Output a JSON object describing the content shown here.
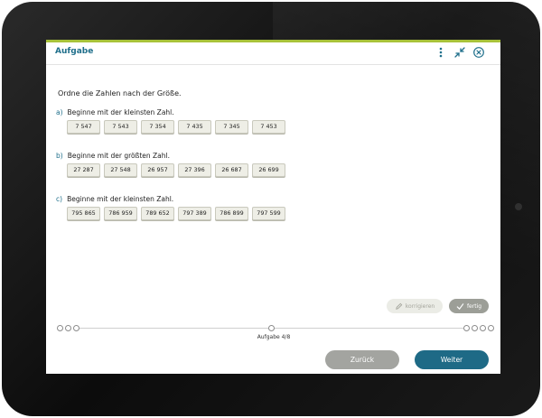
{
  "header": {
    "title": "Aufgabe",
    "icons": [
      "more-vertical-icon",
      "collapse-icon",
      "close-circle-icon"
    ]
  },
  "instruction": "Ordne die Zahlen nach der Größe.",
  "tasks": [
    {
      "letter": "a)",
      "label": "Beginne mit der kleinsten Zahl.",
      "numbers": [
        "7 547",
        "7 543",
        "7 354",
        "7 435",
        "7 345",
        "7 453"
      ]
    },
    {
      "letter": "b)",
      "label": "Beginne mit der größten Zahl.",
      "numbers": [
        "27 287",
        "27 548",
        "26 957",
        "27 396",
        "26 687",
        "26 699"
      ]
    },
    {
      "letter": "c)",
      "label": "Beginne mit der kleinsten Zahl.",
      "numbers": [
        "795 865",
        "786 959",
        "789 652",
        "797 389",
        "786 899",
        "797 599"
      ]
    }
  ],
  "actions": {
    "korrigieren_label": "korrigieren",
    "fertig_label": "fertig"
  },
  "progress": {
    "label": "Aufgabe 4/8",
    "current": 4,
    "total": 8
  },
  "nav": {
    "back_label": "Zurück",
    "next_label": "Weiter"
  },
  "colors": {
    "accent_green": "#a8c23a",
    "brand_teal": "#1f6f8b",
    "primary_button": "#1e6a86",
    "secondary_button": "#a3a4a0"
  }
}
